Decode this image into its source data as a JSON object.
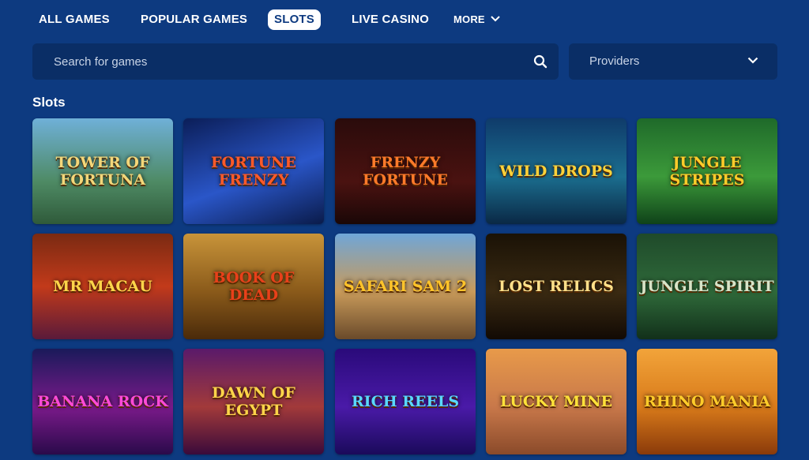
{
  "nav": {
    "items": [
      "ALL GAMES",
      "POPULAR GAMES",
      "SLOTS",
      "LIVE CASINO"
    ],
    "more_label": "MORE",
    "active": "SLOTS"
  },
  "search": {
    "placeholder": "Search for games"
  },
  "providers": {
    "label": "Providers"
  },
  "section": {
    "title": "Slots"
  },
  "games": [
    {
      "name": "TOWER OF FORTUNA",
      "bg": "linear-gradient(180deg,#6fb0d8 0%,#4e8a64 60%,#2f5a3a 100%)",
      "fg": "#f3d77a"
    },
    {
      "name": "FORTUNE FRENZY",
      "bg": "linear-gradient(160deg,#0b1e58 0%,#2a56c8 55%,#0a1b4a 100%)",
      "fg": "#ff5a2a"
    },
    {
      "name": "FRENZY FORTUNE",
      "bg": "linear-gradient(180deg,#2a0b0b 0%,#4a1210 60%,#1a0707 100%)",
      "fg": "#ff7a2a"
    },
    {
      "name": "WILD DROPS",
      "bg": "linear-gradient(180deg,#0f3b6a 0%,#1b6e8f 55%,#0a2845 100%)",
      "fg": "#ffd23a"
    },
    {
      "name": "JUNGLE STRIPES",
      "bg": "linear-gradient(180deg,#1f6a2a 0%,#3c9a3a 55%,#0f4219 100%)",
      "fg": "#ffcc2a"
    },
    {
      "name": "MR MACAU",
      "bg": "linear-gradient(180deg,#7a2a12 0%,#c23a1a 50%,#5a1a3a 100%)",
      "fg": "#ffd54a"
    },
    {
      "name": "BOOK OF DEAD",
      "bg": "linear-gradient(180deg,#c8943a 0%,#8a5a1a 55%,#4a2a0a 100%)",
      "fg": "#e8401a"
    },
    {
      "name": "SAFARI SAM 2",
      "bg": "linear-gradient(180deg,#6fa6d8 0%,#c89a5a 55%,#6a4a2a 100%)",
      "fg": "#ffc42a"
    },
    {
      "name": "LOST RELICS",
      "bg": "linear-gradient(180deg,#1a1206 0%,#3a2a12 55%,#120a04 100%)",
      "fg": "#ffe08a"
    },
    {
      "name": "JUNGLE SPIRIT",
      "bg": "linear-gradient(180deg,#1f4a2a 0%,#2f6a3a 55%,#12301a 100%)",
      "fg": "#d8e4c8"
    },
    {
      "name": "BANANA ROCK",
      "bg": "linear-gradient(180deg,#1a1a5a 0%,#7a1a8a 55%,#2a0a4a 100%)",
      "fg": "#ff4ad8"
    },
    {
      "name": "DAWN OF EGYPT",
      "bg": "linear-gradient(180deg,#5a1a6a 0%,#a23a3a 55%,#3a0a3a 100%)",
      "fg": "#ffd54a"
    },
    {
      "name": "RICH REELS",
      "bg": "linear-gradient(180deg,#2a0a7a 0%,#4a1aa8 55%,#1a0a5a 100%)",
      "fg": "#5ad8ff"
    },
    {
      "name": "LUCKY MINE",
      "bg": "linear-gradient(180deg,#e89a4a 0%,#c8784a 55%,#8a4a2a 100%)",
      "fg": "#ffe23a"
    },
    {
      "name": "RHINO MANIA",
      "bg": "linear-gradient(180deg,#f2a43a 0%,#d87a1a 55%,#8a3a0a 100%)",
      "fg": "#ffcc2a"
    }
  ]
}
